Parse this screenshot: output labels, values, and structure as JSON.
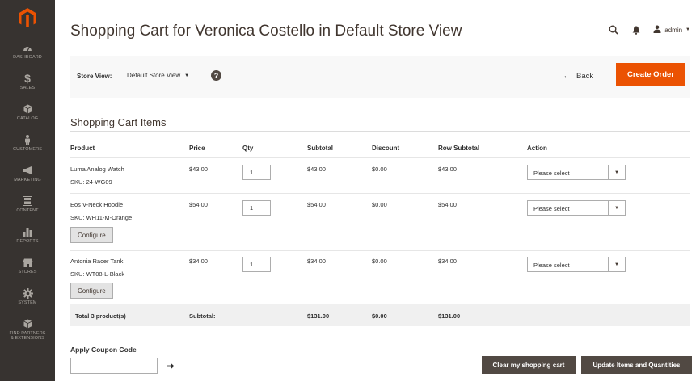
{
  "sidebar": {
    "items": [
      {
        "label": "Dashboard",
        "icon": "dashboard-icon"
      },
      {
        "label": "Sales",
        "icon": "dollar-icon"
      },
      {
        "label": "Catalog",
        "icon": "cube-icon"
      },
      {
        "label": "Customers",
        "icon": "person-icon"
      },
      {
        "label": "Marketing",
        "icon": "megaphone-icon"
      },
      {
        "label": "Content",
        "icon": "layout-icon"
      },
      {
        "label": "Reports",
        "icon": "bar-chart-icon"
      },
      {
        "label": "Stores",
        "icon": "store-icon"
      },
      {
        "label": "System",
        "icon": "gear-icon"
      },
      {
        "label": "Find Partners & Extensions",
        "icon": "cube-icon"
      }
    ]
  },
  "header": {
    "title": "Shopping Cart for Veronica Costello in Default Store View",
    "user": "admin"
  },
  "actions_bar": {
    "store_view_label": "Store View:",
    "store_view_value": "Default Store View",
    "help": "?",
    "back_label": "Back",
    "create_label": "Create Order"
  },
  "section": {
    "title": "Shopping Cart Items"
  },
  "table": {
    "headers": {
      "product": "Product",
      "price": "Price",
      "qty": "Qty",
      "subtotal": "Subtotal",
      "discount": "Discount",
      "row_subtotal": "Row Subtotal",
      "action": "Action"
    },
    "rows": [
      {
        "name": "Luma Analog Watch",
        "sku": "SKU: 24-WG09",
        "price": "$43.00",
        "qty": "1",
        "subtotal": "$43.00",
        "discount": "$0.00",
        "row_subtotal": "$43.00",
        "action": "Please select",
        "configure": ""
      },
      {
        "name": "Eos V-Neck Hoodie",
        "sku": "SKU: WH11-M-Orange",
        "price": "$54.00",
        "qty": "1",
        "subtotal": "$54.00",
        "discount": "$0.00",
        "row_subtotal": "$54.00",
        "action": "Please select",
        "configure": "Configure"
      },
      {
        "name": "Antonia Racer Tank",
        "sku": "SKU: WT08-L-Black",
        "price": "$34.00",
        "qty": "1",
        "subtotal": "$34.00",
        "discount": "$0.00",
        "row_subtotal": "$34.00",
        "action": "Please select",
        "configure": "Configure"
      }
    ],
    "footer": {
      "total_label": "Total 3 product(s)",
      "subtotal_label": "Subtotal:",
      "subtotal": "$131.00",
      "discount": "$0.00",
      "row_subtotal": "$131.00"
    }
  },
  "coupon": {
    "title": "Apply Coupon Code",
    "value": ""
  },
  "buttons": {
    "clear": "Clear my shopping cart",
    "update": "Update Items and Quantities"
  },
  "colors": {
    "sidebar": "#373330",
    "accent": "#eb5202",
    "dark_button": "#514943"
  }
}
